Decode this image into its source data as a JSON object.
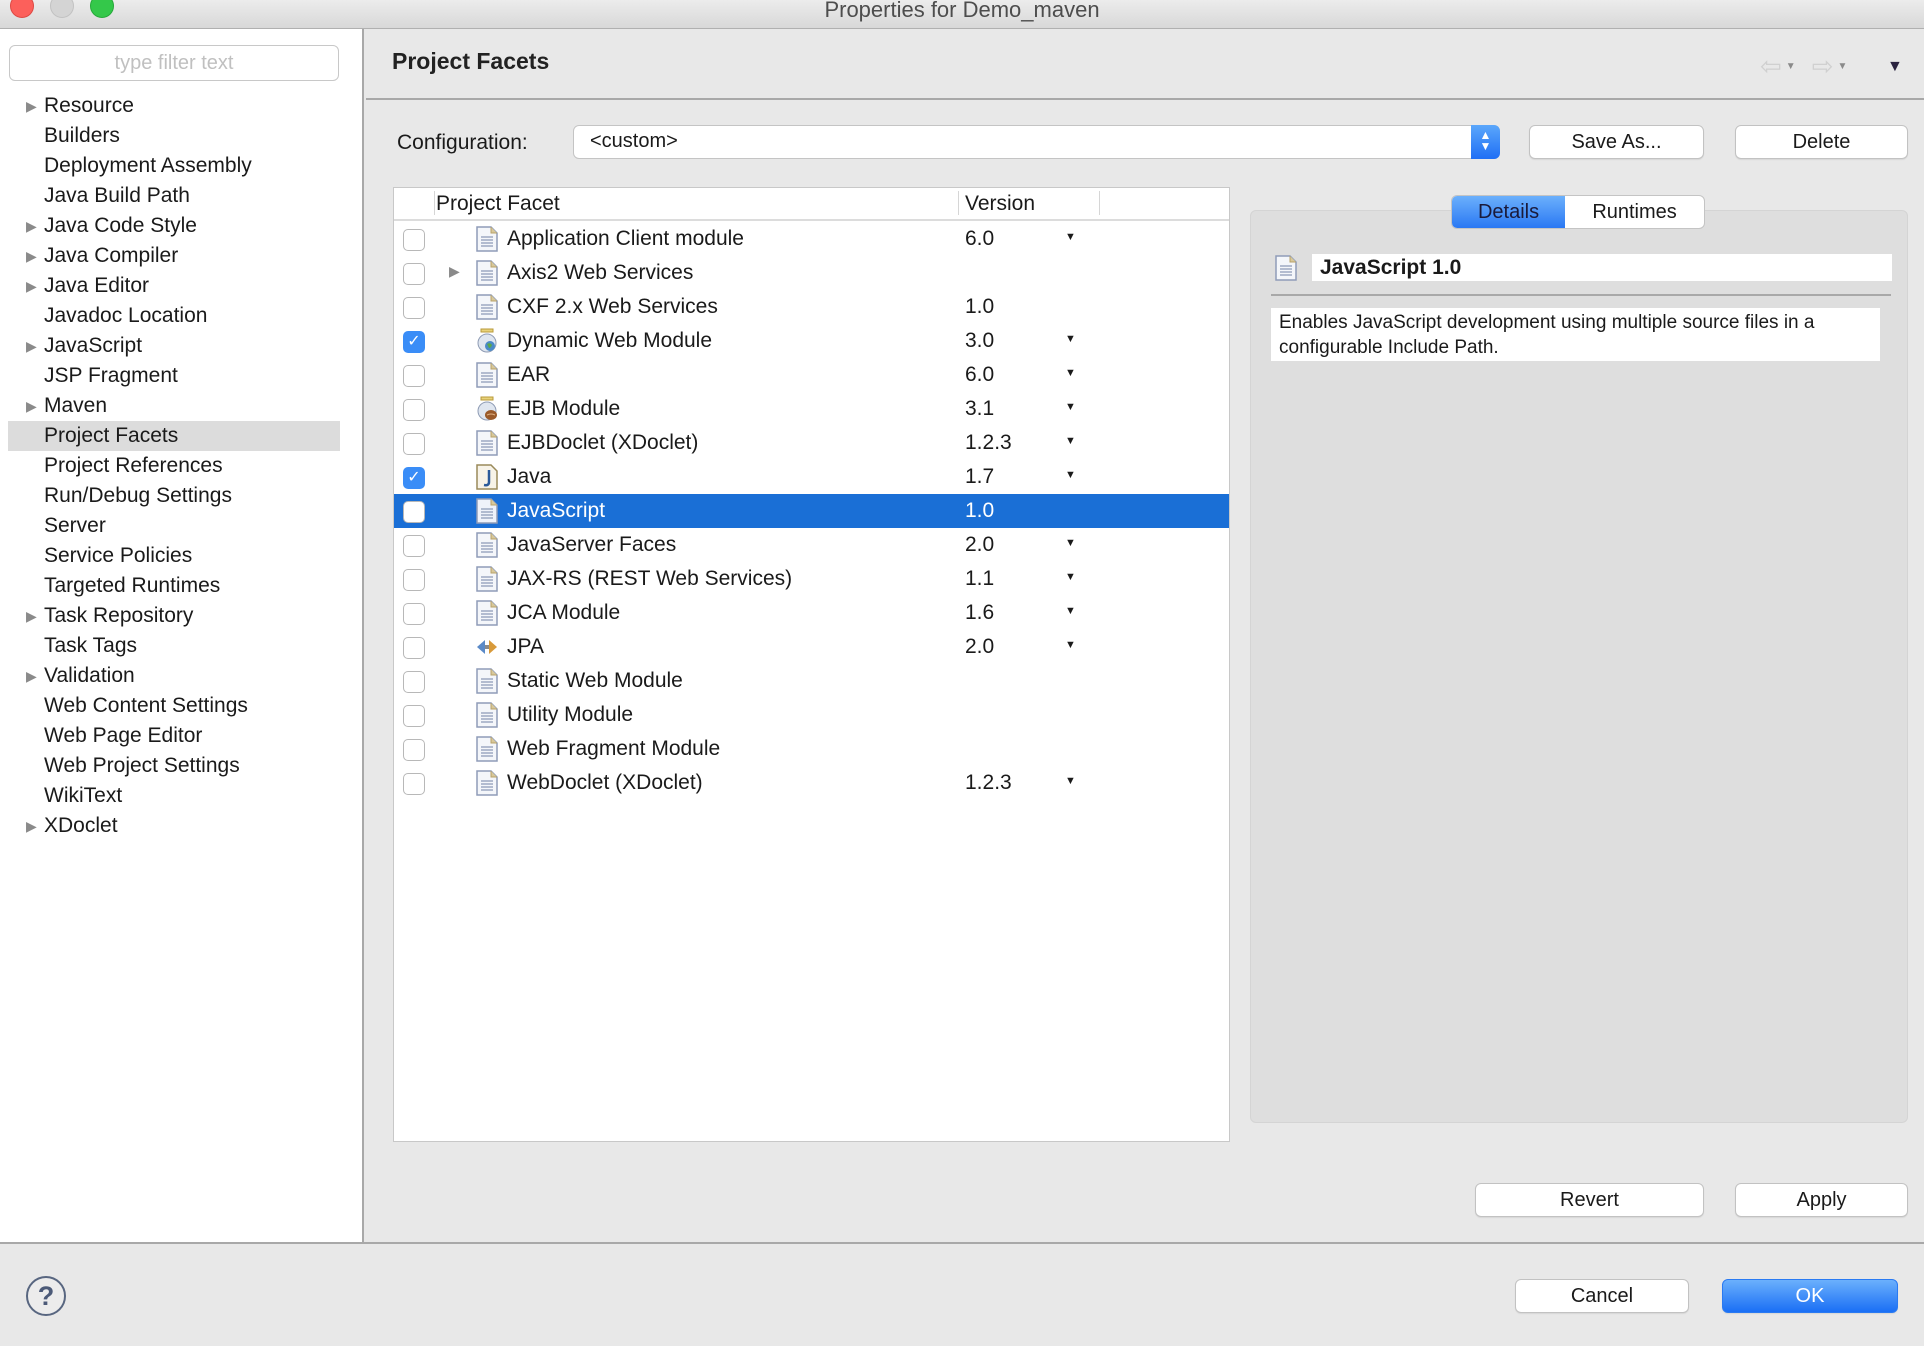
{
  "window": {
    "title": "Properties for Demo_maven"
  },
  "sidebar": {
    "filter_placeholder": "type filter text",
    "items": [
      {
        "label": "Resource",
        "expandable": true
      },
      {
        "label": "Builders",
        "expandable": false
      },
      {
        "label": "Deployment Assembly",
        "expandable": false
      },
      {
        "label": "Java Build Path",
        "expandable": false
      },
      {
        "label": "Java Code Style",
        "expandable": true
      },
      {
        "label": "Java Compiler",
        "expandable": true
      },
      {
        "label": "Java Editor",
        "expandable": true
      },
      {
        "label": "Javadoc Location",
        "expandable": false
      },
      {
        "label": "JavaScript",
        "expandable": true
      },
      {
        "label": "JSP Fragment",
        "expandable": false
      },
      {
        "label": "Maven",
        "expandable": true
      },
      {
        "label": "Project Facets",
        "expandable": false,
        "selected": true
      },
      {
        "label": "Project References",
        "expandable": false
      },
      {
        "label": "Run/Debug Settings",
        "expandable": false
      },
      {
        "label": "Server",
        "expandable": false
      },
      {
        "label": "Service Policies",
        "expandable": false
      },
      {
        "label": "Targeted Runtimes",
        "expandable": false
      },
      {
        "label": "Task Repository",
        "expandable": true
      },
      {
        "label": "Task Tags",
        "expandable": false
      },
      {
        "label": "Validation",
        "expandable": true
      },
      {
        "label": "Web Content Settings",
        "expandable": false
      },
      {
        "label": "Web Page Editor",
        "expandable": false
      },
      {
        "label": "Web Project Settings",
        "expandable": false
      },
      {
        "label": "WikiText",
        "expandable": false
      },
      {
        "label": "XDoclet",
        "expandable": true
      }
    ]
  },
  "header": {
    "title": "Project Facets",
    "back_icon": "back-arrow-icon",
    "forward_icon": "forward-arrow-icon",
    "menu_icon": "view-menu-icon"
  },
  "configuration": {
    "label": "Configuration:",
    "value": "<custom>",
    "save_as_label": "Save As...",
    "delete_label": "Delete"
  },
  "facets_table": {
    "columns": [
      "Project Facet",
      "Version"
    ],
    "rows": [
      {
        "name": "Application Client module",
        "version": "6.0",
        "checked": false,
        "has_dropdown": true,
        "icon": "document-icon"
      },
      {
        "name": "Axis2 Web Services",
        "version": "",
        "checked": false,
        "has_dropdown": false,
        "icon": "document-icon",
        "expandable": true
      },
      {
        "name": "CXF 2.x Web Services",
        "version": "1.0",
        "checked": false,
        "has_dropdown": false,
        "icon": "document-icon"
      },
      {
        "name": "Dynamic Web Module",
        "version": "3.0",
        "checked": true,
        "has_dropdown": true,
        "icon": "web-module-icon"
      },
      {
        "name": "EAR",
        "version": "6.0",
        "checked": false,
        "has_dropdown": true,
        "icon": "document-icon"
      },
      {
        "name": "EJB Module",
        "version": "3.1",
        "checked": false,
        "has_dropdown": true,
        "icon": "ejb-bean-icon"
      },
      {
        "name": "EJBDoclet (XDoclet)",
        "version": "1.2.3",
        "checked": false,
        "has_dropdown": true,
        "icon": "document-icon"
      },
      {
        "name": "Java",
        "version": "1.7",
        "checked": true,
        "has_dropdown": true,
        "icon": "java-icon"
      },
      {
        "name": "JavaScript",
        "version": "1.0",
        "checked": false,
        "has_dropdown": false,
        "icon": "document-icon",
        "selected": true
      },
      {
        "name": "JavaServer Faces",
        "version": "2.0",
        "checked": false,
        "has_dropdown": true,
        "icon": "document-icon"
      },
      {
        "name": "JAX-RS (REST Web Services)",
        "version": "1.1",
        "checked": false,
        "has_dropdown": true,
        "icon": "document-icon"
      },
      {
        "name": "JCA Module",
        "version": "1.6",
        "checked": false,
        "has_dropdown": true,
        "icon": "document-icon"
      },
      {
        "name": "JPA",
        "version": "2.0",
        "checked": false,
        "has_dropdown": true,
        "icon": "jpa-icon"
      },
      {
        "name": "Static Web Module",
        "version": "",
        "checked": false,
        "has_dropdown": false,
        "icon": "document-icon"
      },
      {
        "name": "Utility Module",
        "version": "",
        "checked": false,
        "has_dropdown": false,
        "icon": "document-icon"
      },
      {
        "name": "Web Fragment Module",
        "version": "",
        "checked": false,
        "has_dropdown": false,
        "icon": "document-icon"
      },
      {
        "name": "WebDoclet (XDoclet)",
        "version": "1.2.3",
        "checked": false,
        "has_dropdown": true,
        "icon": "document-icon"
      }
    ]
  },
  "details": {
    "tabs": [
      {
        "label": "Details",
        "active": true
      },
      {
        "label": "Runtimes",
        "active": false
      }
    ],
    "title": "JavaScript 1.0",
    "description": "Enables JavaScript development using multiple source files in a configurable Include Path."
  },
  "actions": {
    "revert_label": "Revert",
    "apply_label": "Apply",
    "cancel_label": "Cancel",
    "ok_label": "OK",
    "help_icon": "help-icon"
  },
  "colors": {
    "accent": "#1a6fd6",
    "checkbox_checked": "#3a8df7",
    "sidebar_selected": "#dcdcdc"
  }
}
